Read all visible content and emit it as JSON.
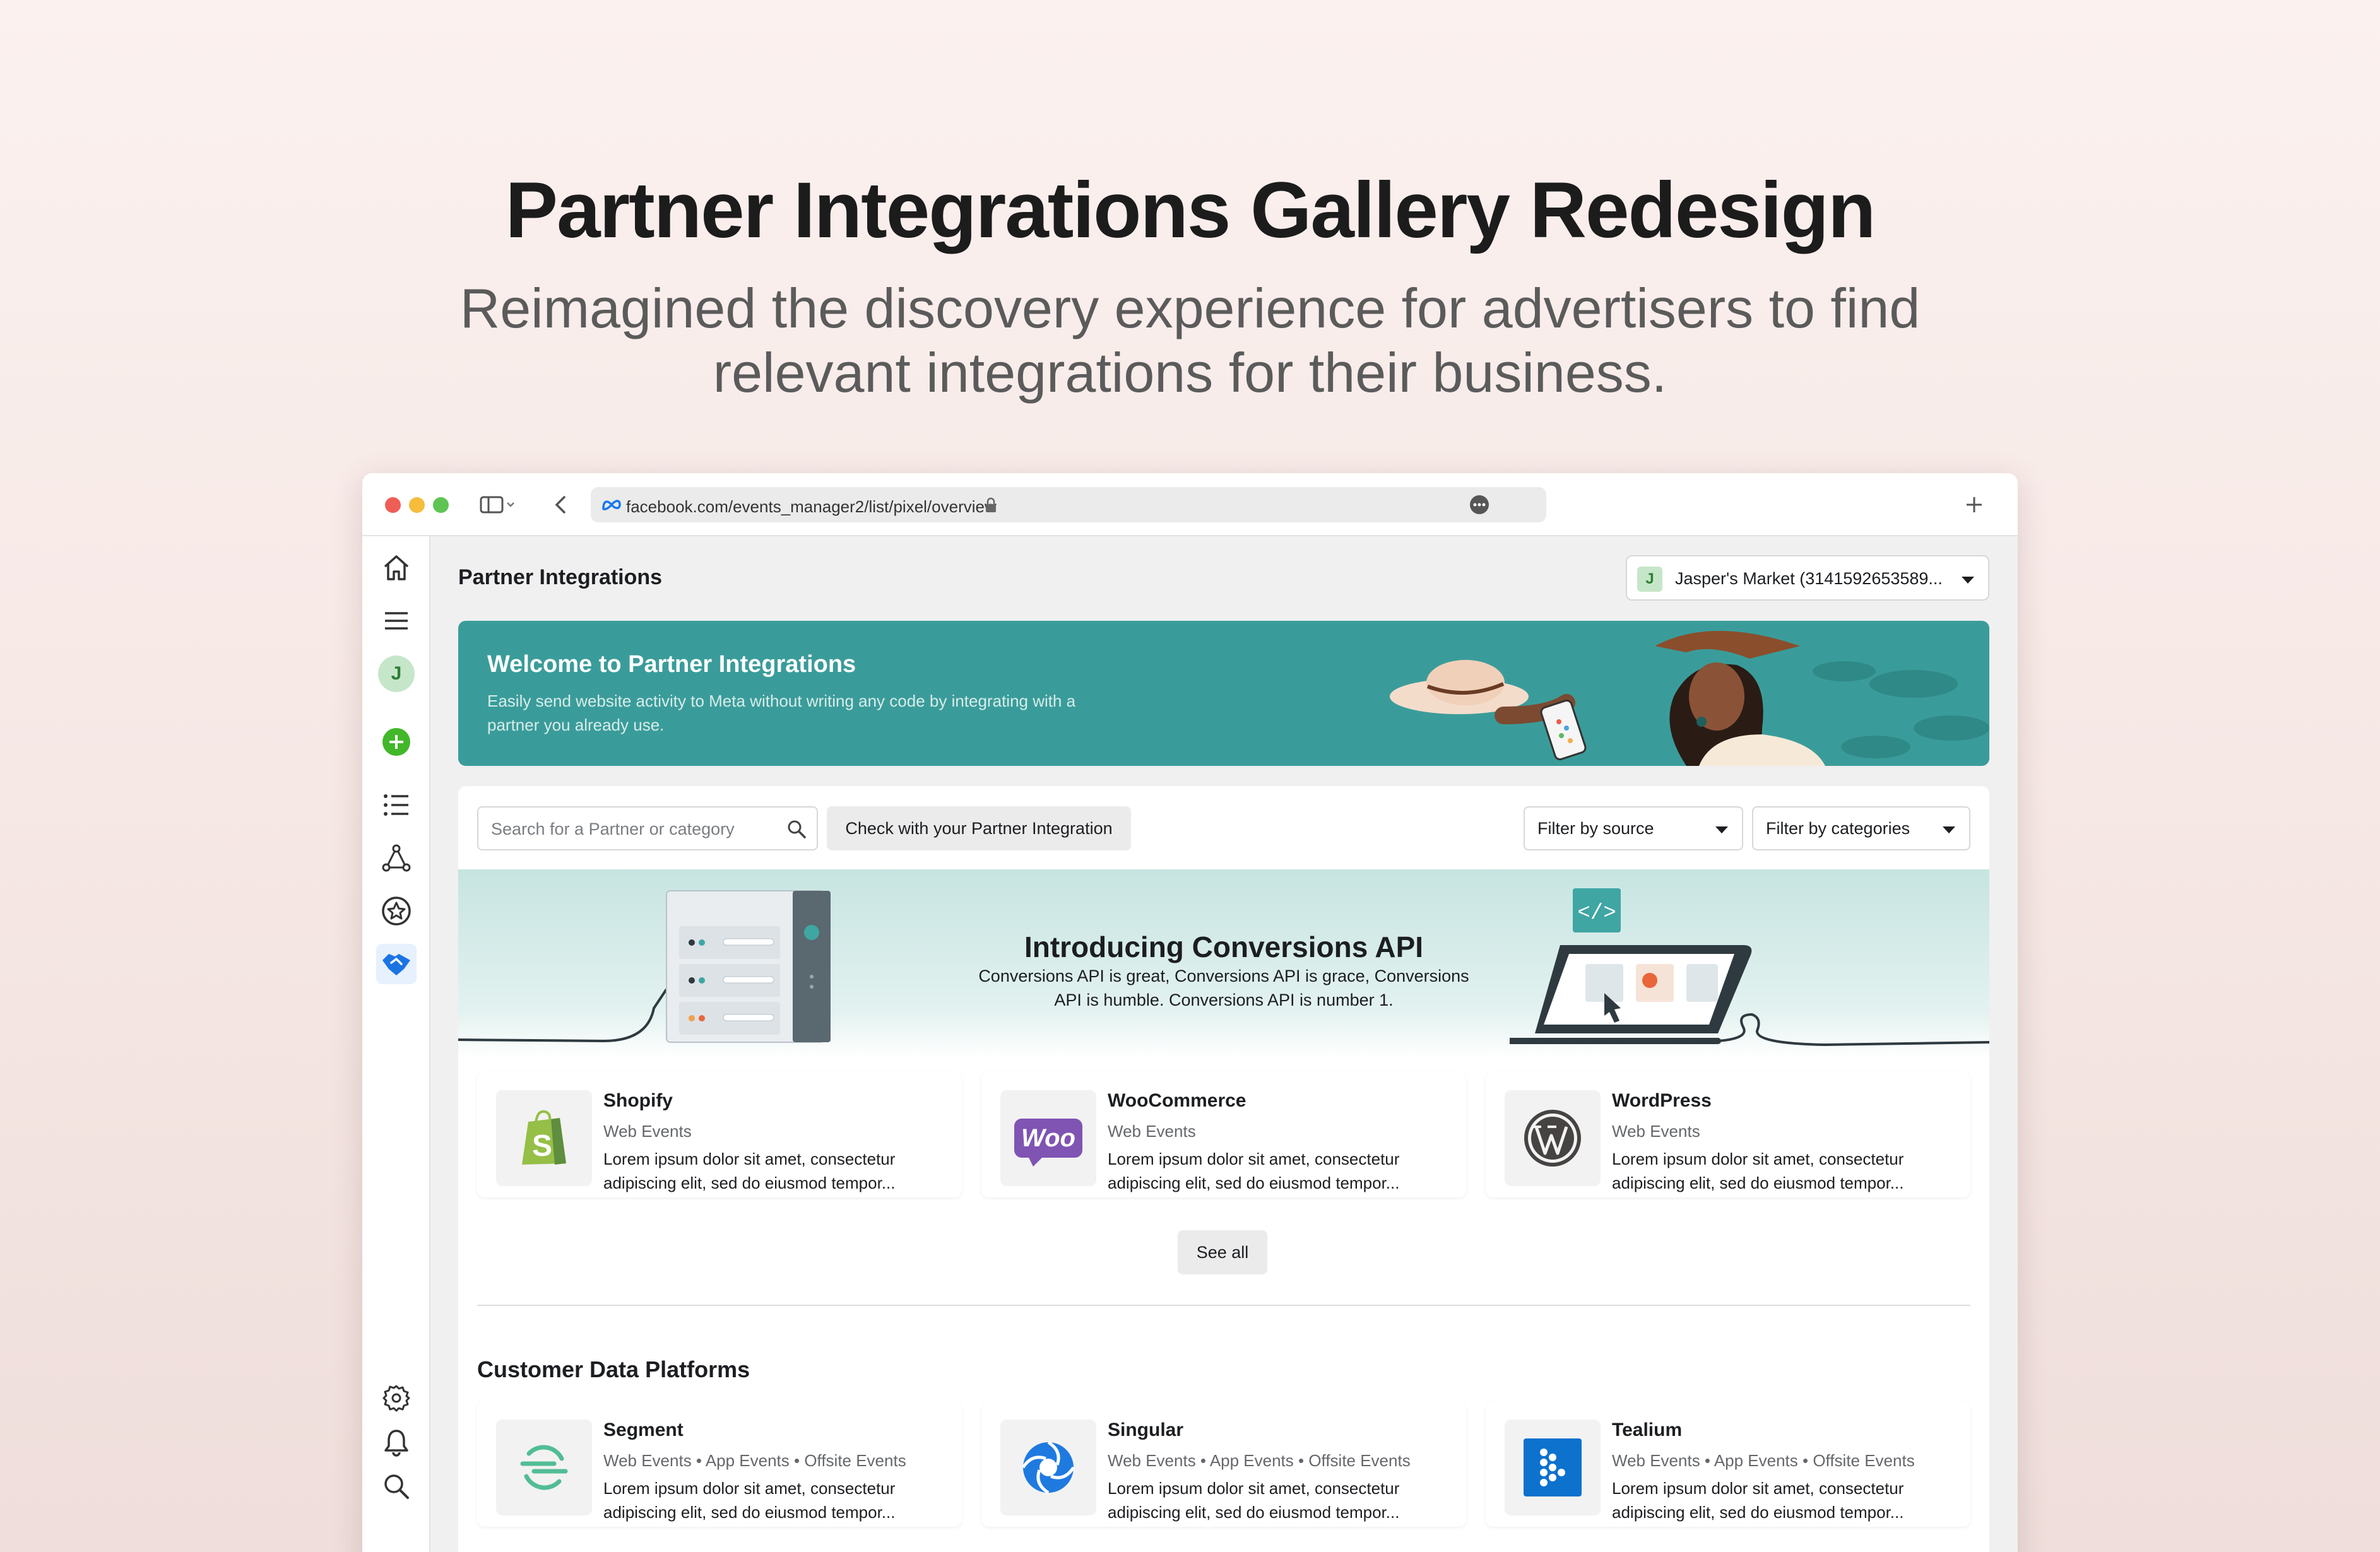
{
  "hero": {
    "title": "Partner Integrations Gallery Redesign",
    "subtitle": "Reimagined the discovery experience for advertisers to find relevant integrations for their business."
  },
  "browser": {
    "url": "facebook.com/events_manager2/list/pixel/overview",
    "traffic_light_colors": [
      "#ee5e56",
      "#f5bd3b",
      "#5fc454"
    ]
  },
  "sidebar": {
    "avatar_initial": "J",
    "items": [
      {
        "name": "home-icon"
      },
      {
        "name": "menu-icon"
      },
      {
        "name": "avatar"
      },
      {
        "name": "add-icon"
      },
      {
        "name": "list-icon"
      },
      {
        "name": "network-icon"
      },
      {
        "name": "star-icon"
      },
      {
        "name": "handshake-icon",
        "active": true
      }
    ],
    "bottom_items": [
      {
        "name": "settings-icon"
      },
      {
        "name": "bell-icon"
      },
      {
        "name": "search-icon"
      }
    ]
  },
  "header": {
    "page_title": "Partner Integrations",
    "account_initial": "J",
    "account_label": "Jasper's Market (3141592653589..."
  },
  "banner": {
    "title": "Welcome to Partner Integrations",
    "description": "Easily send website activity to Meta without writing any code by integrating with a partner you already use."
  },
  "toolbar": {
    "search_placeholder": "Search for a Partner or category",
    "check_button": "Check with your Partner Integration",
    "filter_source": "Filter by source",
    "filter_categories": "Filter by categories"
  },
  "conversions_api": {
    "title": "Introducing Conversions API",
    "description": "Conversions API is great, Conversions API is grace, Conversions API is humble. Conversions API is number 1."
  },
  "featured": [
    {
      "name": "Shopify",
      "type": "Web Events",
      "desc": "Lorem ipsum dolor sit amet, consectetur adipiscing elit, sed do eiusmod tempor...",
      "logo": "shopify-logo"
    },
    {
      "name": "WooCommerce",
      "type": "Web Events",
      "desc": "Lorem ipsum dolor sit amet, consectetur adipiscing elit, sed do eiusmod tempor...",
      "logo": "woocommerce-logo",
      "logo_text": "Woo"
    },
    {
      "name": "WordPress",
      "type": "Web Events",
      "desc": "Lorem ipsum dolor sit amet, consectetur adipiscing elit, sed do eiusmod tempor...",
      "logo": "wordpress-logo"
    }
  ],
  "see_all": "See all",
  "cdp": {
    "title": "Customer Data Platforms",
    "items": [
      {
        "name": "Segment",
        "type": "Web Events • App Events • Offsite Events",
        "desc": "Lorem ipsum dolor sit amet, consectetur adipiscing elit, sed do eiusmod tempor...",
        "logo": "segment-logo"
      },
      {
        "name": "Singular",
        "type": "Web Events • App Events • Offsite Events",
        "desc": "Lorem ipsum dolor sit amet, consectetur adipiscing elit, sed do eiusmod tempor...",
        "logo": "singular-logo"
      },
      {
        "name": "Tealium",
        "type": "Web Events • App Events • Offsite Events",
        "desc": "Lorem ipsum dolor sit amet, consectetur adipiscing elit, sed do eiusmod tempor...",
        "logo": "tealium-logo"
      }
    ]
  },
  "colors": {
    "banner": "#3a9c9a",
    "active_nav": "#1b74e4",
    "shopify": "#95bf47",
    "woocommerce": "#7f54b3",
    "segment": "#52bd94",
    "singular": "#1f7ae0",
    "tealium": "#0c72ce"
  }
}
